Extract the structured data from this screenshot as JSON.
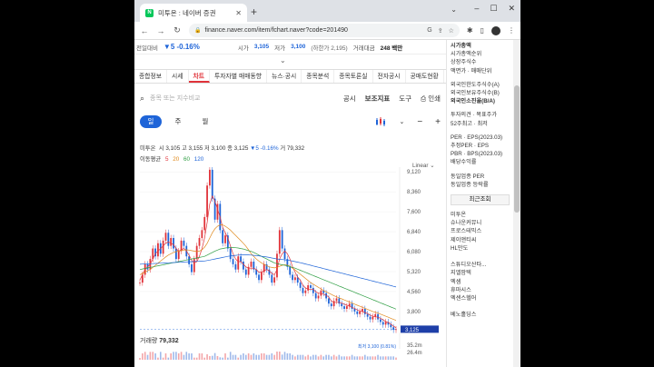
{
  "browser": {
    "tab_title": "미투온 : 네이버 증권",
    "url": "finance.naver.com/item/fchart.naver?code=201490",
    "window_controls": [
      "–",
      "☐",
      "✕"
    ]
  },
  "price_bar": {
    "prev_label": "전일대비",
    "change": "▼5  -0.16%",
    "high_label": "시가",
    "high_value": "3,105",
    "low_label": "저가",
    "low_value": "3,100",
    "low_sub": "(하한가 2,195)",
    "amount_label": "거래대금",
    "amount_value": "248 백만"
  },
  "tabs": [
    "종합정보",
    "시세",
    "차트",
    "투자자별 매매동향",
    "뉴스·공시",
    "종목분석",
    "종목토론실",
    "전자공시",
    "공매도현황"
  ],
  "active_tab": "차트",
  "toolbar": {
    "search_placeholder": "종목 또는 지수비교",
    "items": [
      "공시",
      "보조지표",
      "도구",
      "인쇄"
    ]
  },
  "period": {
    "buttons": [
      "일",
      "주",
      "월"
    ],
    "active": "일"
  },
  "ohlc": {
    "name": "미투온",
    "text_open": "시 3,105",
    "text_high": "고 3,155",
    "text_low": "저 3,100",
    "text_close": "종 3,125",
    "text_change": "▼5 -0.16%",
    "text_volume": "거 79,332"
  },
  "moving_average": {
    "label": "이동평균",
    "values": [
      "5",
      "20",
      "60",
      "120"
    ],
    "colors": [
      "#e0333a",
      "#e08a1e",
      "#2f9e44",
      "#1e64d8"
    ]
  },
  "scale_mode": "Linear",
  "chart_data": {
    "type": "line",
    "y_ticks": [
      "9,120",
      "8,360",
      "7,600",
      "6,840",
      "6,080",
      "5,320",
      "4,560",
      "3,800"
    ],
    "max_label": "최고 9,200 (-66.58%)",
    "min_label": "최저 3,100 (0.81%)",
    "current_price_label": "3,125",
    "volume_label": "거래량",
    "volume_value": "79,332",
    "volume_scale": [
      "35.2m",
      "26.4m"
    ],
    "ylim": [
      3000,
      9300
    ],
    "price": [
      4900,
      5200,
      5600,
      5400,
      5800,
      6200,
      5900,
      6400,
      6000,
      6500,
      6800,
      6300,
      6600,
      6200,
      5800,
      6100,
      6500,
      6300,
      5900,
      5600,
      5300,
      5800,
      6300,
      6600,
      6900,
      7400,
      8600,
      9200,
      8100,
      7300,
      7900,
      6900,
      6400,
      6700,
      6200,
      5800,
      5600,
      5400,
      5900,
      5700,
      5400,
      5200,
      5500,
      5700,
      5400,
      5200,
      5000,
      5300,
      5600,
      5400,
      5200,
      4900,
      5100,
      6000,
      6900,
      6200,
      5800,
      5500,
      5200,
      5000,
      5100,
      4900,
      4700,
      4500,
      4600,
      4800,
      4700,
      4500,
      4300,
      4400,
      4600,
      4500,
      4300,
      4100,
      4000,
      4200,
      4300,
      4100,
      4000,
      3900,
      4000,
      4100,
      3900,
      3800,
      3700,
      3800,
      3900,
      3700,
      3600,
      3500,
      3600,
      3700,
      3500,
      3400,
      3300,
      3400,
      3300,
      3200,
      3100,
      3125
    ],
    "ma_series": [
      {
        "name": "5",
        "values": [
          5000,
          5200,
          5400,
          5500,
          5600,
          5800,
          6000,
          6100,
          6200,
          6300,
          6400,
          6450,
          6400,
          6350,
          6200,
          6100,
          6150,
          6200,
          6100,
          5950,
          5750,
          5650,
          5700,
          5900,
          6200,
          6600,
          7200,
          7900,
          8200,
          8000,
          7700,
          7400,
          7000,
          6800,
          6600,
          6300,
          6000,
          5800,
          5700,
          5700,
          5600,
          5500,
          5450,
          5450,
          5450,
          5400,
          5300,
          5300,
          5350,
          5400,
          5350,
          5250,
          5200,
          5400,
          5800,
          6000,
          6100,
          6000,
          5800,
          5500,
          5300,
          5100,
          5000,
          4800,
          4700,
          4650,
          4650,
          4650,
          4550,
          4500,
          4480,
          4460,
          4420,
          4350,
          4200,
          4150,
          4150,
          4150,
          4120,
          4080,
          4040,
          4000,
          3950,
          3920,
          3860,
          3820,
          3800,
          3760,
          3720,
          3660,
          3620,
          3600,
          3580,
          3540,
          3480,
          3420,
          3380,
          3320,
          3240,
          3180
        ]
      },
      {
        "name": "20",
        "values": [
          5200,
          5250,
          5300,
          5350,
          5400,
          5480,
          5560,
          5640,
          5720,
          5800,
          5880,
          5950,
          6000,
          6050,
          6080,
          6100,
          6120,
          6140,
          6150,
          6140,
          6120,
          6100,
          6080,
          6100,
          6150,
          6250,
          6400,
          6600,
          6800,
          6950,
          7050,
          7100,
          7100,
          7050,
          6980,
          6900,
          6800,
          6700,
          6600,
          6500,
          6400,
          6280,
          6150,
          6000,
          5900,
          5800,
          5720,
          5650,
          5600,
          5550,
          5500,
          5480,
          5460,
          5480,
          5520,
          5560,
          5580,
          5560,
          5520,
          5450,
          5380,
          5300,
          5220,
          5140,
          5060,
          4980,
          4900,
          4840,
          4780,
          4720,
          4660,
          4600,
          4550,
          4500,
          4450,
          4400,
          4360,
          4320,
          4280,
          4240,
          4200,
          4160,
          4120,
          4080,
          4040,
          4000,
          3960,
          3920,
          3880,
          3840,
          3800,
          3770,
          3740,
          3700,
          3660,
          3620,
          3580,
          3540,
          3500,
          3460
        ]
      },
      {
        "name": "60",
        "values": [
          5400,
          5420,
          5440,
          5460,
          5480,
          5500,
          5520,
          5540,
          5560,
          5580,
          5600,
          5620,
          5640,
          5660,
          5680,
          5700,
          5720,
          5740,
          5760,
          5780,
          5800,
          5820,
          5840,
          5860,
          5880,
          5900,
          5950,
          6000,
          6050,
          6100,
          6140,
          6180,
          6200,
          6220,
          6230,
          6240,
          6240,
          6230,
          6220,
          6200,
          6180,
          6150,
          6120,
          6090,
          6050,
          6000,
          5950,
          5900,
          5850,
          5800,
          5750,
          5700,
          5650,
          5620,
          5600,
          5580,
          5560,
          5540,
          5510,
          5480,
          5450,
          5410,
          5370,
          5330,
          5290,
          5250,
          5210,
          5170,
          5130,
          5090,
          5050,
          5010,
          4970,
          4930,
          4890,
          4850,
          4810,
          4770,
          4730,
          4690,
          4650,
          4610,
          4570,
          4530,
          4490,
          4450,
          4410,
          4370,
          4330,
          4290,
          4250,
          4210,
          4170,
          4130,
          4090,
          4050,
          4010,
          3970,
          3930,
          3890
        ]
      },
      {
        "name": "120",
        "values": [
          5600,
          5605,
          5610,
          5615,
          5620,
          5625,
          5630,
          5635,
          5640,
          5645,
          5650,
          5655,
          5660,
          5665,
          5670,
          5675,
          5680,
          5685,
          5690,
          5695,
          5700,
          5705,
          5710,
          5715,
          5720,
          5725,
          5740,
          5760,
          5780,
          5800,
          5820,
          5840,
          5860,
          5880,
          5900,
          5915,
          5930,
          5940,
          5950,
          5955,
          5960,
          5960,
          5955,
          5950,
          5940,
          5930,
          5920,
          5905,
          5890,
          5875,
          5860,
          5840,
          5820,
          5800,
          5790,
          5780,
          5770,
          5755,
          5740,
          5720,
          5700,
          5680,
          5660,
          5635,
          5610,
          5585,
          5560,
          5535,
          5510,
          5485,
          5460,
          5435,
          5410,
          5385,
          5360,
          5335,
          5310,
          5285,
          5260,
          5235,
          5210,
          5185,
          5160,
          5135,
          5110,
          5085,
          5060,
          5035,
          5010,
          4985,
          4960,
          4935,
          4910,
          4885,
          4860,
          4835,
          4810,
          4785,
          4760,
          4735
        ]
      }
    ]
  },
  "sidebar": {
    "group1": [
      "시가총액",
      "시가총액순위",
      "상장주식수",
      "액면가 · 매매단위"
    ],
    "group2": [
      "외국인한도주식수(A)",
      "외국인보유주식수(B)",
      "외국인소진율(B/A)"
    ],
    "group3": [
      "투자의견 · 목표주가",
      "52주최고 · 최저"
    ],
    "group4": [
      "PER · EPS(2023.03)",
      "추정PER · EPS",
      "PBR · BPS(2023.03)",
      "배당수익률"
    ],
    "group5": [
      "동일업종 PER",
      "동일업종 등락률"
    ],
    "recent_title": "최근조회",
    "recent": [
      "미투온",
      "슈나운커뮤니",
      "프로스테믹스",
      "제이앤티씨",
      "HL만도",
      "",
      "스튜디오산타...",
      "지엘팜텍",
      "엑셈",
      "휴마시스",
      "엑센스헬어",
      "",
      "베노홀딩스"
    ]
  }
}
